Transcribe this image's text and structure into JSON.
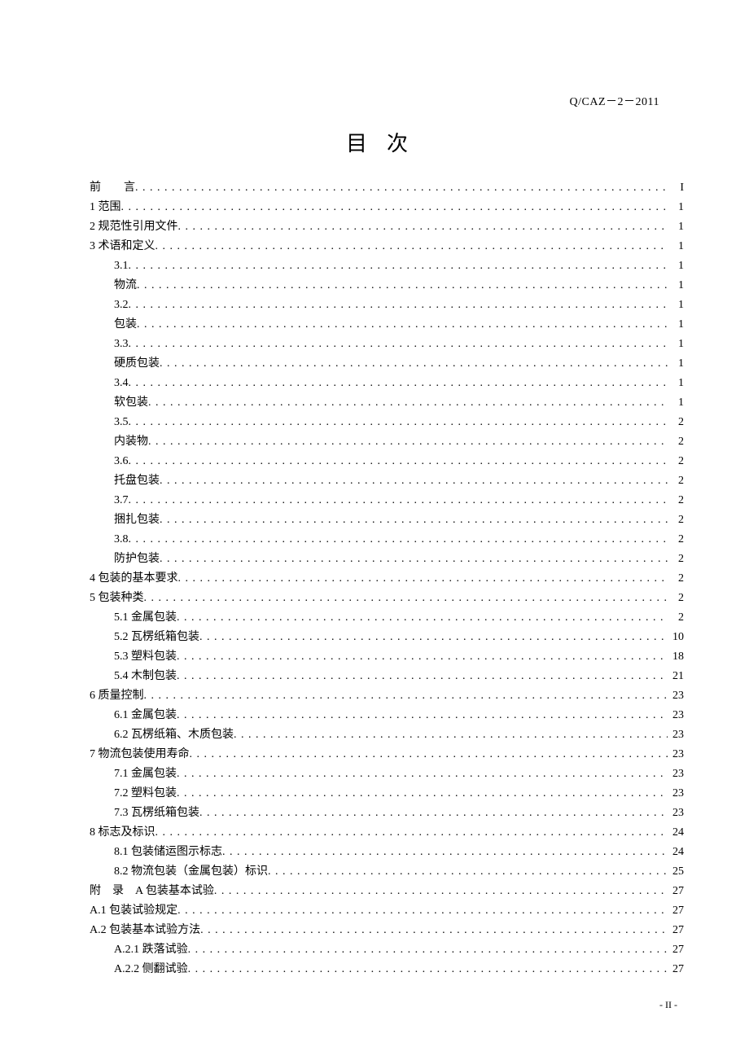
{
  "header": {
    "doc_code": "Q/CAZ－2－2011"
  },
  "title": "目次",
  "toc": [
    {
      "label": "前　　言",
      "page": "I",
      "level": 0,
      "cls": "qy"
    },
    {
      "label": "1  范围",
      "page": "1",
      "level": 0
    },
    {
      "label": "2  规范性引用文件",
      "page": "1",
      "level": 0
    },
    {
      "label": "3  术语和定义",
      "page": "1",
      "level": 0
    },
    {
      "label": "3.1 ",
      "page": "1",
      "level": 1
    },
    {
      "label": "物流",
      "page": "1",
      "level": 1
    },
    {
      "label": "3.2 ",
      "page": "1",
      "level": 1
    },
    {
      "label": "包装",
      "page": "1",
      "level": 1
    },
    {
      "label": "3.3 ",
      "page": "1",
      "level": 1
    },
    {
      "label": "硬质包装",
      "page": "1",
      "level": 1
    },
    {
      "label": "3.4 ",
      "page": "1",
      "level": 1
    },
    {
      "label": "软包装",
      "page": "1",
      "level": 1
    },
    {
      "label": "3.5 ",
      "page": "2",
      "level": 1
    },
    {
      "label": "内装物",
      "page": "2",
      "level": 1
    },
    {
      "label": "3.6 ",
      "page": "2",
      "level": 1
    },
    {
      "label": "托盘包装",
      "page": "2",
      "level": 1
    },
    {
      "label": "3.7 ",
      "page": "2",
      "level": 1
    },
    {
      "label": "捆扎包装",
      "page": "2",
      "level": 1
    },
    {
      "label": "3.8 ",
      "page": "2",
      "level": 1
    },
    {
      "label": "防护包装",
      "page": "2",
      "level": 1
    },
    {
      "label": "4  包装的基本要求",
      "page": "2",
      "level": 0
    },
    {
      "label": "5  包装种类",
      "page": "2",
      "level": 0
    },
    {
      "label": "5.1  金属包装 ",
      "page": "2",
      "level": 1
    },
    {
      "label": "5.2  瓦楞纸箱包装 ",
      "page": "10",
      "level": 1
    },
    {
      "label": "5.3  塑料包装 ",
      "page": "18",
      "level": 1
    },
    {
      "label": "5.4  木制包装 ",
      "page": "21",
      "level": 1
    },
    {
      "label": "6  质量控制",
      "page": "23",
      "level": 0
    },
    {
      "label": "6.1  金属包装 ",
      "page": "23",
      "level": 1
    },
    {
      "label": "6.2  瓦楞纸箱、木质包装 ",
      "page": "23",
      "level": 1
    },
    {
      "label": "7  物流包装使用寿命",
      "page": "23",
      "level": 0
    },
    {
      "label": "7.1  金属包装 ",
      "page": "23",
      "level": 1
    },
    {
      "label": "7.2  塑料包装 ",
      "page": "23",
      "level": 1
    },
    {
      "label": "7.3  瓦楞纸箱包装 ",
      "page": "23",
      "level": 1
    },
    {
      "label": "8  标志及标识",
      "page": "24",
      "level": 0
    },
    {
      "label": "8.1  包装储运图示标志 ",
      "page": "24",
      "level": 1
    },
    {
      "label": "8.2  物流包装（金属包装）标识 ",
      "page": "25",
      "level": 1
    },
    {
      "label": "附　录　A  包装基本试验 ",
      "page": "27",
      "level": 0,
      "cls": "fl"
    },
    {
      "label": "A.1  包装试验规定",
      "page": "27",
      "level": 0
    },
    {
      "label": "A.2  包装基本试验方法",
      "page": "27",
      "level": 0
    },
    {
      "label": "A.2.1  跌落试验 ",
      "page": "27",
      "level": 2
    },
    {
      "label": "A.2.2  侧翻试验 ",
      "page": "27",
      "level": 2
    }
  ],
  "footer": {
    "page_number": "- II -"
  }
}
